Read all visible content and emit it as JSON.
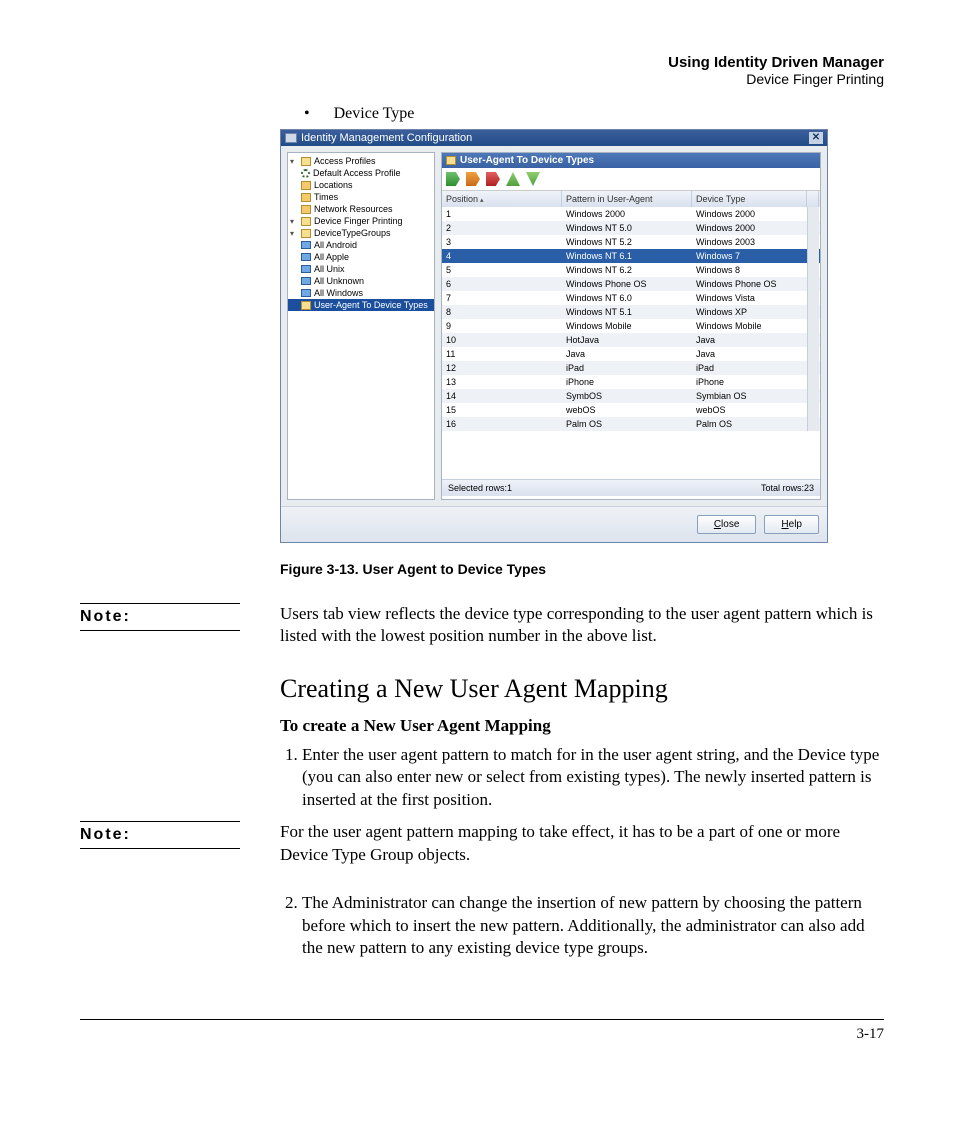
{
  "header": {
    "t1": "Using Identity Driven Manager",
    "t2": "Device Finger Printing"
  },
  "bullet1": "Device Type",
  "dialog": {
    "title": "Identity Management Configuration",
    "tree": {
      "access_profiles": "Access Profiles",
      "default_profile": "Default Access Profile",
      "locations": "Locations",
      "times": "Times",
      "network_resources": "Network Resources",
      "device_fp": "Device Finger Printing",
      "dtg": "DeviceTypeGroups",
      "all_android": "All Android",
      "all_apple": "All Apple",
      "all_unix": "All Unix",
      "all_unknown": "All Unknown",
      "all_windows": "All Windows",
      "ua_to_dt": "User-Agent To Device Types"
    },
    "panel_title": "User-Agent To Device Types",
    "cols": {
      "c1": "Position",
      "c2": "Pattern in User-Agent",
      "c3": "Device Type"
    },
    "rows": [
      {
        "p": "1",
        "ua": "Windows 2000",
        "dt": "Windows 2000"
      },
      {
        "p": "2",
        "ua": "Windows NT 5.0",
        "dt": "Windows 2000"
      },
      {
        "p": "3",
        "ua": "Windows NT 5.2",
        "dt": "Windows 2003"
      },
      {
        "p": "4",
        "ua": "Windows NT 6.1",
        "dt": "Windows 7"
      },
      {
        "p": "5",
        "ua": "Windows NT 6.2",
        "dt": "Windows 8"
      },
      {
        "p": "6",
        "ua": "Windows Phone OS",
        "dt": "Windows Phone OS"
      },
      {
        "p": "7",
        "ua": "Windows NT 6.0",
        "dt": "Windows Vista"
      },
      {
        "p": "8",
        "ua": "Windows NT 5.1",
        "dt": "Windows XP"
      },
      {
        "p": "9",
        "ua": "Windows Mobile",
        "dt": "Windows Mobile"
      },
      {
        "p": "10",
        "ua": "HotJava",
        "dt": "Java"
      },
      {
        "p": "11",
        "ua": "Java",
        "dt": "Java"
      },
      {
        "p": "12",
        "ua": "iPad",
        "dt": "iPad"
      },
      {
        "p": "13",
        "ua": "iPhone",
        "dt": "iPhone"
      },
      {
        "p": "14",
        "ua": "SymbOS",
        "dt": "Symbian OS"
      },
      {
        "p": "15",
        "ua": "webOS",
        "dt": "webOS"
      },
      {
        "p": "16",
        "ua": "Palm OS",
        "dt": "Palm OS"
      }
    ],
    "footer": {
      "left": "Selected rows:1",
      "right": "Total rows:23"
    },
    "btn_close": "Close",
    "btn_help": "Help"
  },
  "caption": "Figure 3-13. User Agent to Device Types",
  "note_label": "Note:",
  "note1": "Users tab view reflects the device type corresponding to the user agent pattern which is listed with the lowest position number in the above list.",
  "h2": "Creating a New User Agent Mapping",
  "sub1": "To create a New User Agent Mapping",
  "step1": "Enter the user agent pattern to match for in the user agent string, and the Device type (you can also enter new or select from existing types). The newly inserted pattern is inserted at the first position.",
  "note2": "For the user agent pattern mapping to take effect, it has to be a part of one or more Device Type Group objects.",
  "step2": "The Administrator can change the insertion of new pattern by choosing the pattern before which to insert the new pattern. Additionally, the administrator can also add the new pattern to any existing device type groups.",
  "pgnum": "3-17"
}
